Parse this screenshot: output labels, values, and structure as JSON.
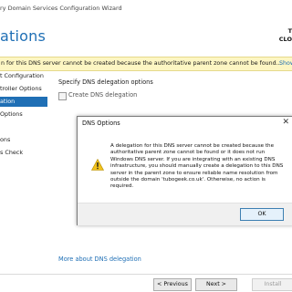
{
  "window": {
    "title": "ry Domain Services Configuration Wizard"
  },
  "header": {
    "title": "ations",
    "target_line1": "T",
    "target_line2": "CLO"
  },
  "warning_bar": {
    "message": "n for this DNS server cannot be created because the authoritative parent zone cannot be found...",
    "link": "Show"
  },
  "nav": {
    "items": [
      {
        "label": "t Configuration"
      },
      {
        "label": "troller Options"
      },
      {
        "label": "ation"
      },
      {
        "label": "Options"
      },
      {
        "label": ""
      },
      {
        "label": "ons"
      },
      {
        "label": "s Check"
      },
      {
        "label": ""
      }
    ]
  },
  "main": {
    "section_label": "Specify DNS delegation options",
    "create_delegation_label": "Create DNS delegation",
    "create_delegation_checked": false,
    "more_link": "More about DNS delegation"
  },
  "footer": {
    "previous_label": "< Previous",
    "next_label": "Next >",
    "install_label": "Install"
  },
  "dialog": {
    "title": "DNS Options",
    "close_glyph": "✕",
    "message": "A delegation for this DNS server cannot be created because the authoritative parent zone cannot be found or it does not run Windows DNS server. If you are integrating with an existing DNS infrastructure, you should manually create a delegation to this DNS server in the parent zone to ensure reliable name resolution from outside the domain 'tubogeek.co.uk'. Otherwise, no action is required.",
    "ok_label": "OK",
    "icon": "warning-icon"
  },
  "colors": {
    "accent": "#1f6fb5",
    "warning_bg": "#fdf6c3",
    "warning_icon": "#f2c21b"
  }
}
